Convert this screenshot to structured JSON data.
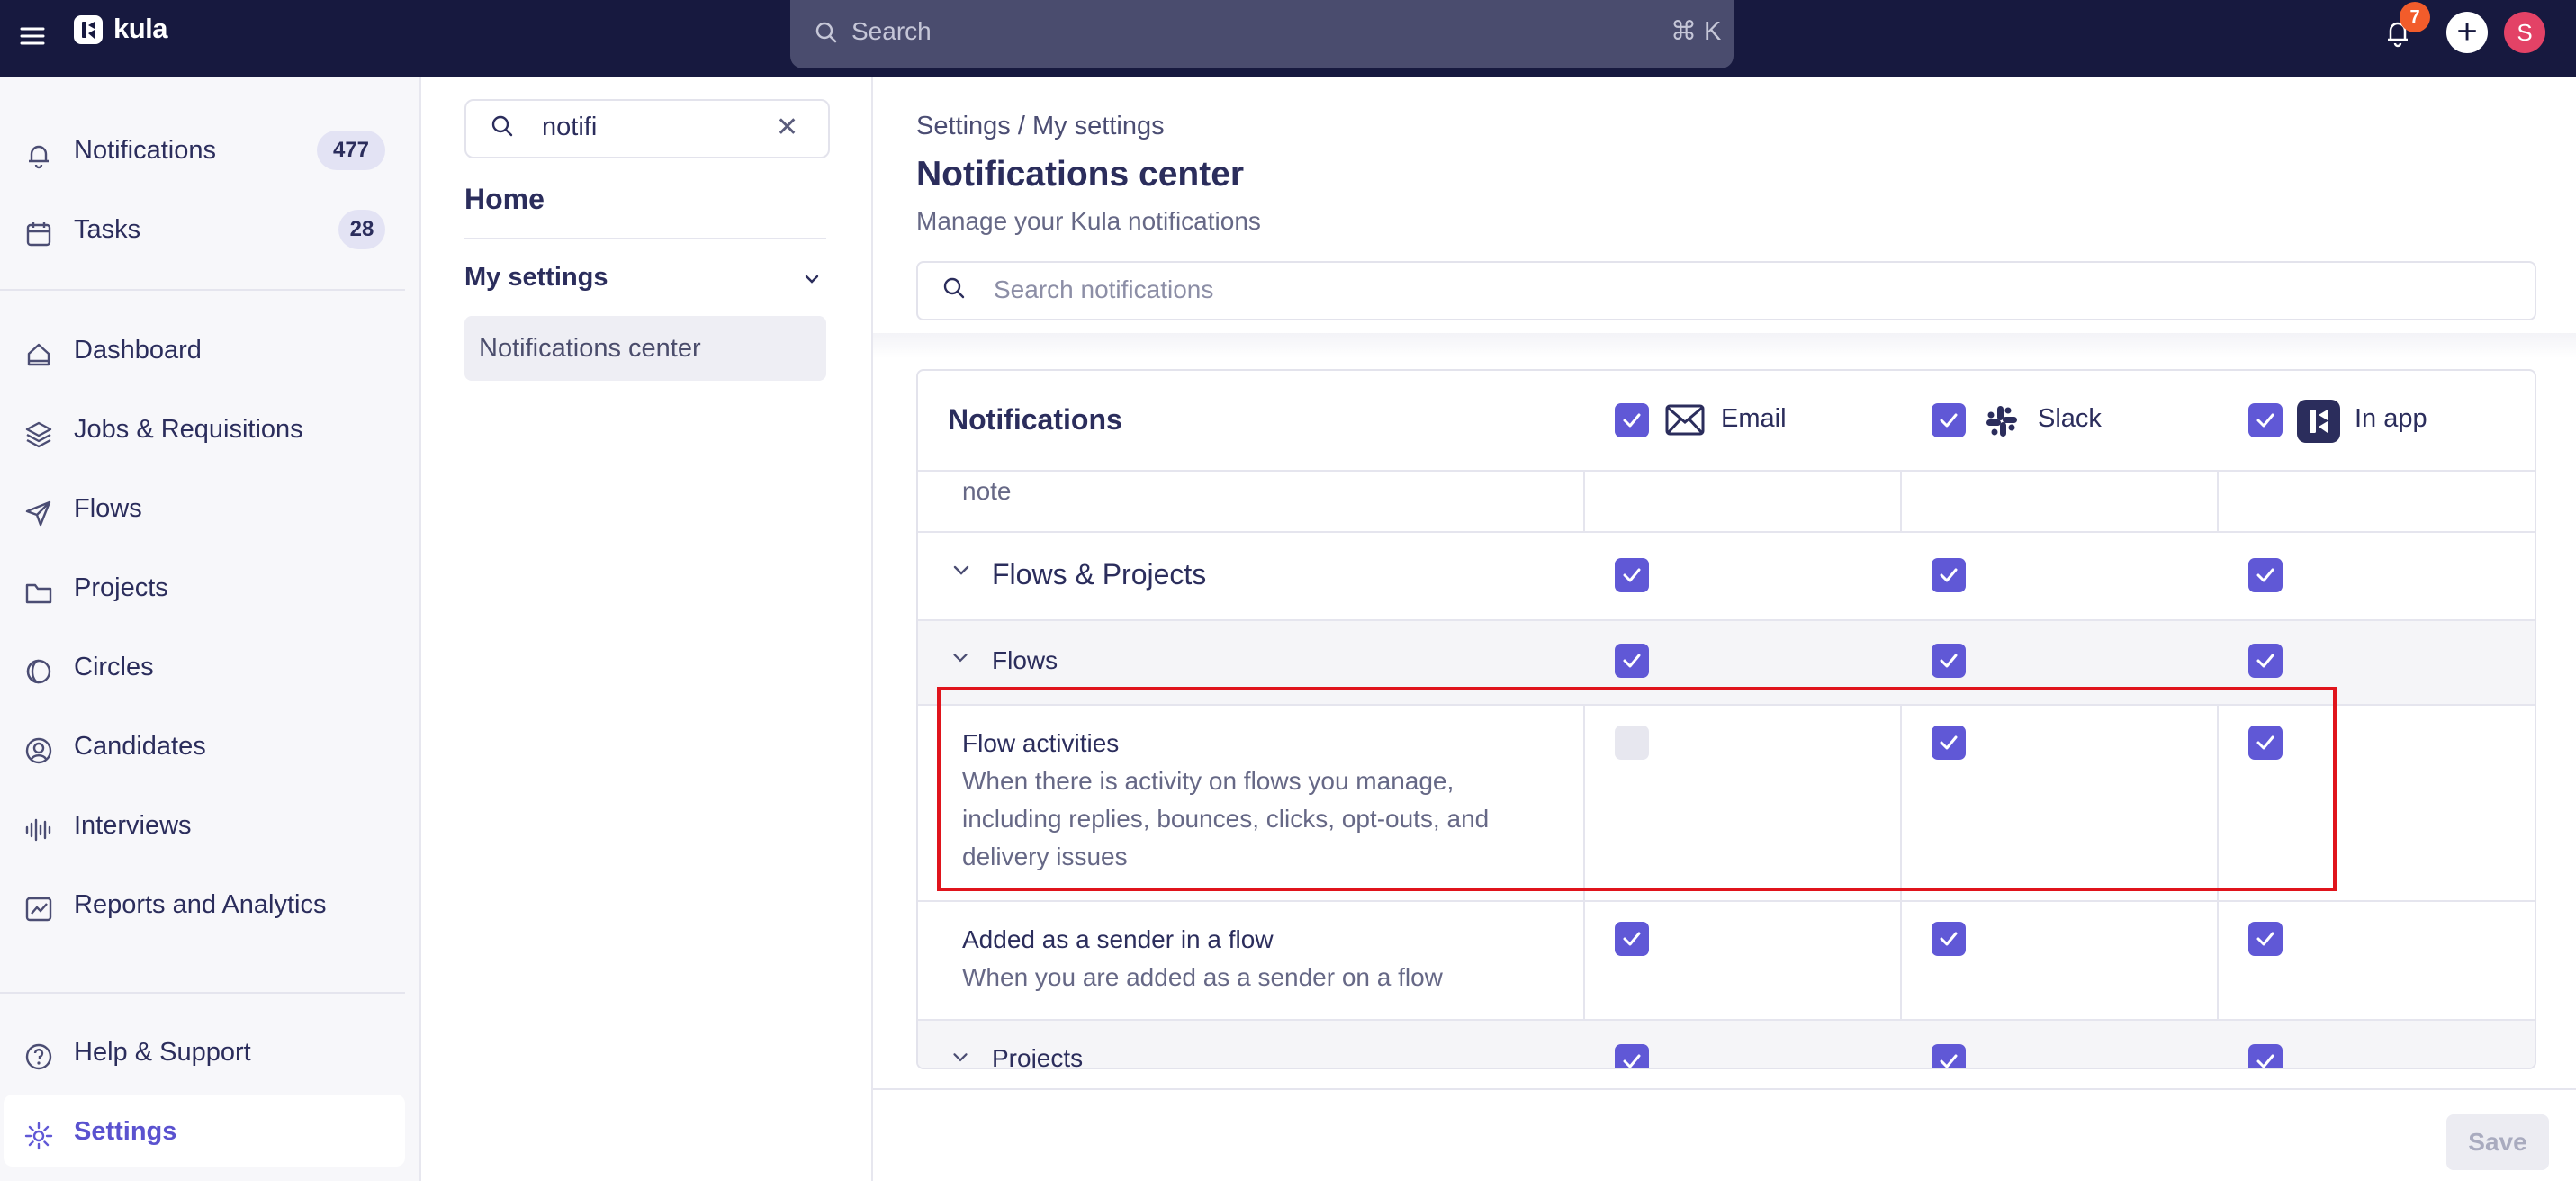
{
  "app": {
    "name": "kula"
  },
  "topbar": {
    "search_placeholder": "Search",
    "search_shortcut": "⌘ K",
    "notification_count": "7",
    "avatar_initial": "S"
  },
  "sidebar": {
    "items": [
      {
        "label": "Notifications",
        "badge": "477",
        "icon": "bell-icon"
      },
      {
        "label": "Tasks",
        "badge": "28",
        "icon": "calendar-icon"
      },
      {
        "label": "Dashboard",
        "icon": "home-icon"
      },
      {
        "label": "Jobs & Requisitions",
        "icon": "layers-icon"
      },
      {
        "label": "Flows",
        "icon": "send-icon"
      },
      {
        "label": "Projects",
        "icon": "folder-icon"
      },
      {
        "label": "Circles",
        "icon": "circle-half-icon"
      },
      {
        "label": "Candidates",
        "icon": "user-circle-icon"
      },
      {
        "label": "Interviews",
        "icon": "audio-wave-icon"
      },
      {
        "label": "Reports and Analytics",
        "icon": "chart-icon"
      }
    ],
    "footer": [
      {
        "label": "Help & Support",
        "icon": "help-icon"
      },
      {
        "label": "Settings",
        "icon": "gear-icon"
      }
    ]
  },
  "settings_panel": {
    "search_value": "notifi",
    "home": "Home",
    "group": "My settings",
    "active_item": "Notifications center"
  },
  "main": {
    "breadcrumb": "Settings / My settings",
    "title": "Notifications center",
    "subtitle": "Manage your Kula notifications",
    "search_placeholder": "Search notifications",
    "save_label": "Save"
  },
  "table": {
    "header": "Notifications",
    "channels": [
      "Email",
      "Slack",
      "In app"
    ],
    "truncated_row": "note",
    "rows": [
      {
        "type": "section",
        "label": "Flows & Projects",
        "checks": [
          true,
          true,
          true
        ]
      },
      {
        "type": "group",
        "label": "Flows",
        "checks": [
          true,
          true,
          true
        ]
      },
      {
        "type": "item",
        "label": "Flow activities",
        "desc": [
          "When there is activity on flows you manage,",
          "including replies, bounces, clicks, opt-outs, and",
          "delivery issues"
        ],
        "checks": [
          false,
          true,
          true
        ]
      },
      {
        "type": "item",
        "label": "Added as a sender in a flow",
        "desc": [
          "When you are added as a sender on a flow"
        ],
        "checks": [
          true,
          true,
          true
        ]
      },
      {
        "type": "group",
        "label": "Projects",
        "checks": [
          true,
          true,
          true
        ]
      }
    ]
  },
  "colors": {
    "accent": "#6058d6",
    "topbar": "#17193f",
    "highlight": "#e0141c"
  }
}
